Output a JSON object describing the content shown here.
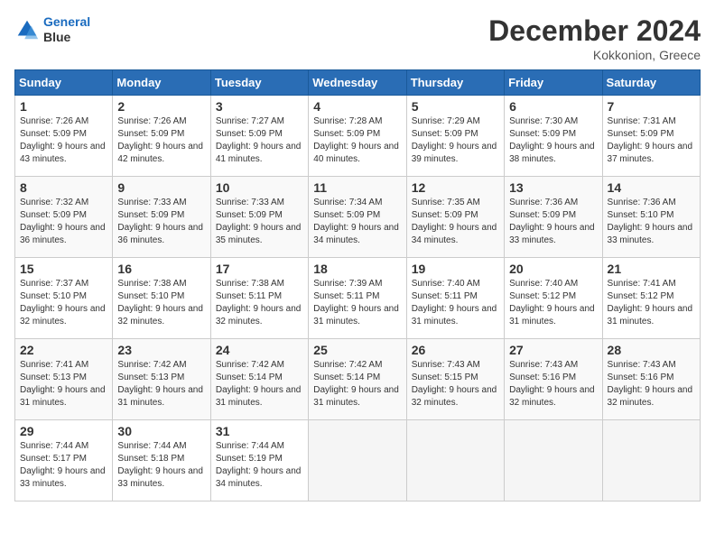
{
  "header": {
    "logo_line1": "General",
    "logo_line2": "Blue",
    "month": "December 2024",
    "location": "Kokkonion, Greece"
  },
  "weekdays": [
    "Sunday",
    "Monday",
    "Tuesday",
    "Wednesday",
    "Thursday",
    "Friday",
    "Saturday"
  ],
  "weeks": [
    [
      {
        "day": 1,
        "sunrise": "7:26 AM",
        "sunset": "5:09 PM",
        "daylight": "9 hours and 43 minutes."
      },
      {
        "day": 2,
        "sunrise": "7:26 AM",
        "sunset": "5:09 PM",
        "daylight": "9 hours and 42 minutes."
      },
      {
        "day": 3,
        "sunrise": "7:27 AM",
        "sunset": "5:09 PM",
        "daylight": "9 hours and 41 minutes."
      },
      {
        "day": 4,
        "sunrise": "7:28 AM",
        "sunset": "5:09 PM",
        "daylight": "9 hours and 40 minutes."
      },
      {
        "day": 5,
        "sunrise": "7:29 AM",
        "sunset": "5:09 PM",
        "daylight": "9 hours and 39 minutes."
      },
      {
        "day": 6,
        "sunrise": "7:30 AM",
        "sunset": "5:09 PM",
        "daylight": "9 hours and 38 minutes."
      },
      {
        "day": 7,
        "sunrise": "7:31 AM",
        "sunset": "5:09 PM",
        "daylight": "9 hours and 37 minutes."
      }
    ],
    [
      {
        "day": 8,
        "sunrise": "7:32 AM",
        "sunset": "5:09 PM",
        "daylight": "9 hours and 36 minutes."
      },
      {
        "day": 9,
        "sunrise": "7:33 AM",
        "sunset": "5:09 PM",
        "daylight": "9 hours and 36 minutes."
      },
      {
        "day": 10,
        "sunrise": "7:33 AM",
        "sunset": "5:09 PM",
        "daylight": "9 hours and 35 minutes."
      },
      {
        "day": 11,
        "sunrise": "7:34 AM",
        "sunset": "5:09 PM",
        "daylight": "9 hours and 34 minutes."
      },
      {
        "day": 12,
        "sunrise": "7:35 AM",
        "sunset": "5:09 PM",
        "daylight": "9 hours and 34 minutes."
      },
      {
        "day": 13,
        "sunrise": "7:36 AM",
        "sunset": "5:09 PM",
        "daylight": "9 hours and 33 minutes."
      },
      {
        "day": 14,
        "sunrise": "7:36 AM",
        "sunset": "5:10 PM",
        "daylight": "9 hours and 33 minutes."
      }
    ],
    [
      {
        "day": 15,
        "sunrise": "7:37 AM",
        "sunset": "5:10 PM",
        "daylight": "9 hours and 32 minutes."
      },
      {
        "day": 16,
        "sunrise": "7:38 AM",
        "sunset": "5:10 PM",
        "daylight": "9 hours and 32 minutes."
      },
      {
        "day": 17,
        "sunrise": "7:38 AM",
        "sunset": "5:11 PM",
        "daylight": "9 hours and 32 minutes."
      },
      {
        "day": 18,
        "sunrise": "7:39 AM",
        "sunset": "5:11 PM",
        "daylight": "9 hours and 31 minutes."
      },
      {
        "day": 19,
        "sunrise": "7:40 AM",
        "sunset": "5:11 PM",
        "daylight": "9 hours and 31 minutes."
      },
      {
        "day": 20,
        "sunrise": "7:40 AM",
        "sunset": "5:12 PM",
        "daylight": "9 hours and 31 minutes."
      },
      {
        "day": 21,
        "sunrise": "7:41 AM",
        "sunset": "5:12 PM",
        "daylight": "9 hours and 31 minutes."
      }
    ],
    [
      {
        "day": 22,
        "sunrise": "7:41 AM",
        "sunset": "5:13 PM",
        "daylight": "9 hours and 31 minutes."
      },
      {
        "day": 23,
        "sunrise": "7:42 AM",
        "sunset": "5:13 PM",
        "daylight": "9 hours and 31 minutes."
      },
      {
        "day": 24,
        "sunrise": "7:42 AM",
        "sunset": "5:14 PM",
        "daylight": "9 hours and 31 minutes."
      },
      {
        "day": 25,
        "sunrise": "7:42 AM",
        "sunset": "5:14 PM",
        "daylight": "9 hours and 31 minutes."
      },
      {
        "day": 26,
        "sunrise": "7:43 AM",
        "sunset": "5:15 PM",
        "daylight": "9 hours and 32 minutes."
      },
      {
        "day": 27,
        "sunrise": "7:43 AM",
        "sunset": "5:16 PM",
        "daylight": "9 hours and 32 minutes."
      },
      {
        "day": 28,
        "sunrise": "7:43 AM",
        "sunset": "5:16 PM",
        "daylight": "9 hours and 32 minutes."
      }
    ],
    [
      {
        "day": 29,
        "sunrise": "7:44 AM",
        "sunset": "5:17 PM",
        "daylight": "9 hours and 33 minutes."
      },
      {
        "day": 30,
        "sunrise": "7:44 AM",
        "sunset": "5:18 PM",
        "daylight": "9 hours and 33 minutes."
      },
      {
        "day": 31,
        "sunrise": "7:44 AM",
        "sunset": "5:19 PM",
        "daylight": "9 hours and 34 minutes."
      },
      null,
      null,
      null,
      null
    ]
  ]
}
